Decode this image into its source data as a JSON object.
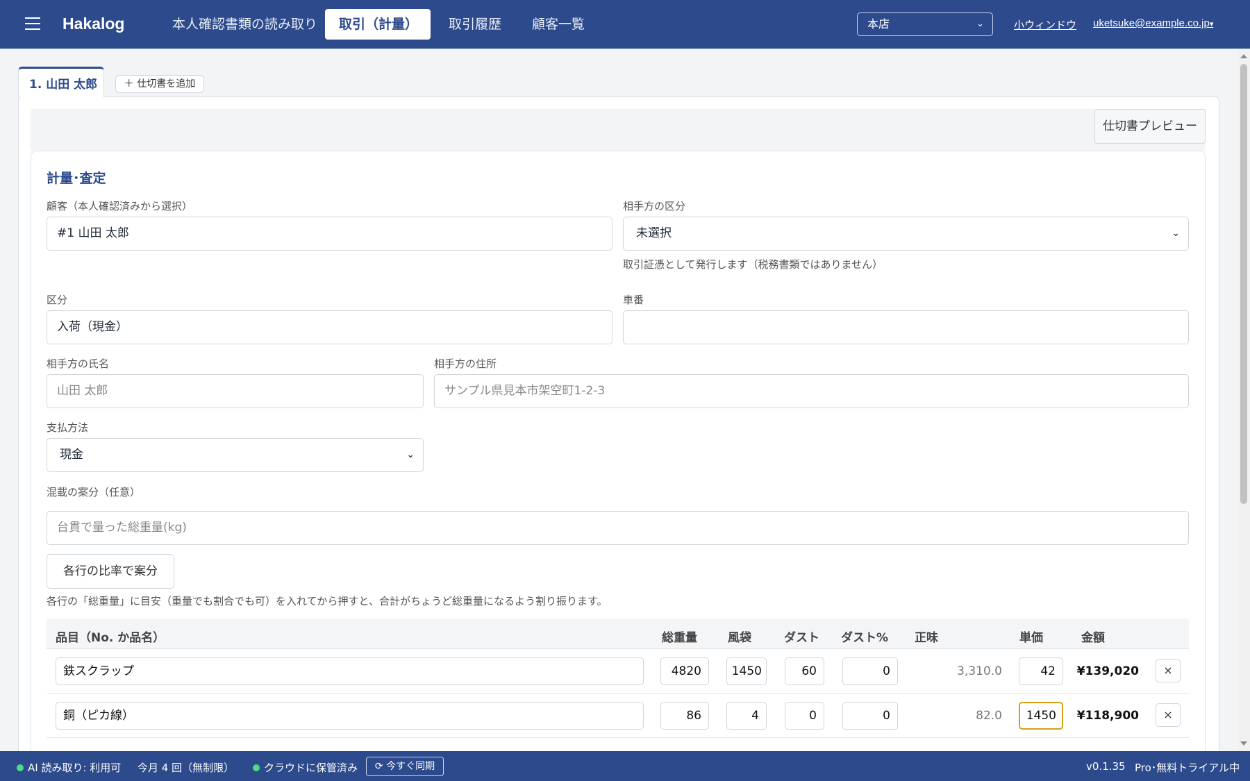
{
  "app": {
    "brand": "Hakalog",
    "nav_tabs": [
      "本人確認書類の読み取り",
      "取引（計量）",
      "取引履歴",
      "顧客一覧"
    ],
    "branch": "本店",
    "small_window_link": "小ウィンドウ",
    "user_email": "uketsuke@example.co.jp",
    "user_menu_caret": "▾"
  },
  "doc_tabs": {
    "active_tab": "1. 山田 太郎",
    "add_button": "＋ 仕切書を追加"
  },
  "toolbar": {
    "preview_button": "仕切書プレビュー"
  },
  "form": {
    "section_title": "計量･査定",
    "customer": {
      "label": "顧客（本人確認済みから選択）",
      "value": "#1 山田 太郎"
    },
    "partner_type": {
      "label": "相手方の区分",
      "value": "未選択",
      "hint": "取引証憑として発行します（税務書類ではありません）"
    },
    "category": {
      "label": "区分",
      "value": "入荷（現金）"
    },
    "vehicle_number": {
      "label": "車番",
      "value": ""
    },
    "partner_name": {
      "label": "相手方の氏名",
      "placeholder": "山田 太郎"
    },
    "partner_address": {
      "label": "相手方の住所",
      "placeholder": "サンプル県見本市架空町1-2-3"
    },
    "payment_method": {
      "label": "支払方法",
      "value": "現金"
    },
    "mixed_load": {
      "label": "混載の案分（任意）",
      "placeholder": "台貫で量った総重量(kg)",
      "button": "各行の比率で案分",
      "hint": "各行の「総重量」に目安（重量でも割合でも可）を入れてから押すと、合計がちょうど総重量になるよう割り振ります。"
    }
  },
  "items_table": {
    "headers": {
      "item": "品目（No. か品名）",
      "gross": "総重量",
      "bag": "風袋",
      "dust": "ダスト",
      "dust_pct": "ダスト%",
      "net": "正味",
      "unit_price": "単価",
      "amount": "金額"
    },
    "rows": [
      {
        "item": "鉄スクラップ",
        "gross": "4820",
        "bag": "1450",
        "dust": "60",
        "dust_pct": "0",
        "net": "3,310.0",
        "unit_price": "42",
        "amount": "¥139,020",
        "remove": "×"
      },
      {
        "item": "銅（ピカ線）",
        "gross": "86",
        "bag": "4",
        "dust": "0",
        "dust_pct": "0",
        "net": "82.0",
        "unit_price": "1450",
        "amount": "¥118,900",
        "remove": "×"
      }
    ]
  },
  "status_bar": {
    "ai_reading": "AI 読み取り: 利用可",
    "monthly_count": "今月 4 回（無制限）",
    "cloud": "クラウドに保管済み",
    "sync_button": "⟳ 今すぐ同期",
    "version": "v0.1.35",
    "plan": "Pro･無料トライアル中"
  },
  "colors": {
    "primary": "#2c4a8c",
    "focus_border": "#d4a017",
    "status_dot": "#4ade80"
  }
}
